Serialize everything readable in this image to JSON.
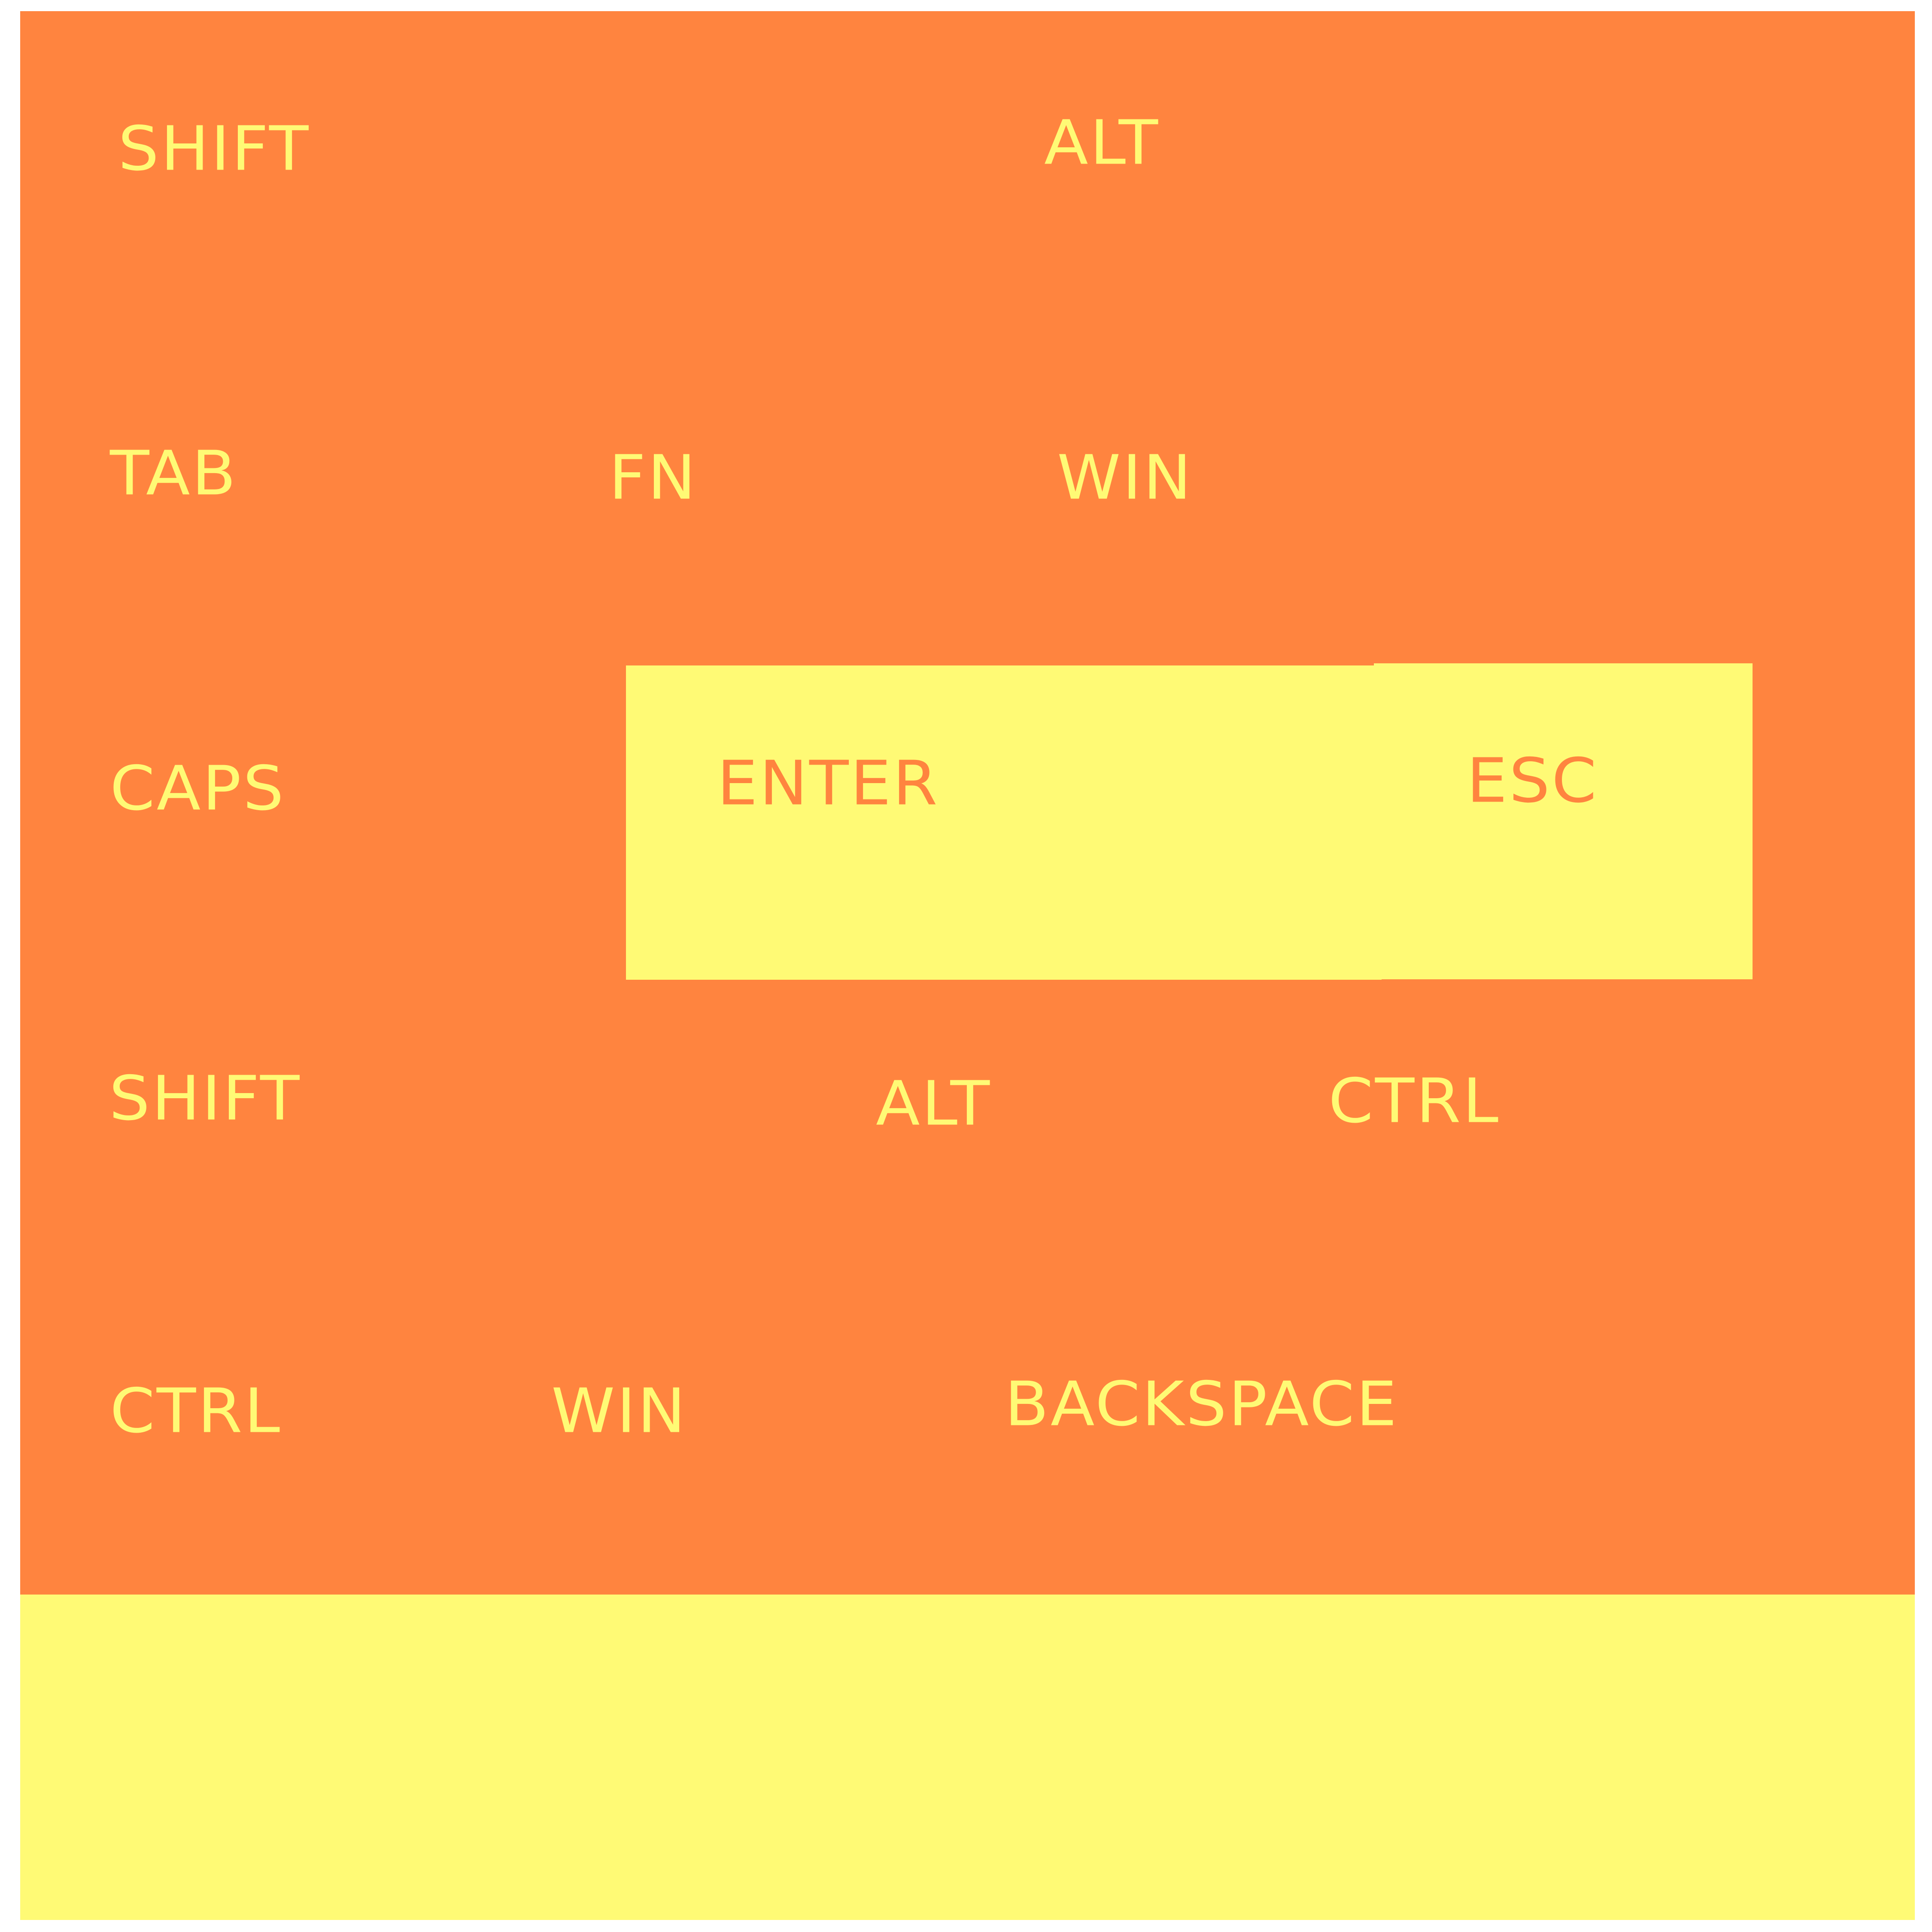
{
  "colors": {
    "orange": "#ff843f",
    "yellow": "#fffa75",
    "background": "#ffffff"
  },
  "keys": {
    "row1": [
      "SHIFT",
      "ALT"
    ],
    "row2": [
      "TAB",
      "FN",
      "WIN"
    ],
    "row3": [
      "CAPS",
      "ENTER",
      "ESC"
    ],
    "row4": [
      "SHIFT",
      "ALT",
      "CTRL"
    ],
    "row5": [
      "CTRL",
      "WIN",
      "BACKSPACE"
    ]
  }
}
